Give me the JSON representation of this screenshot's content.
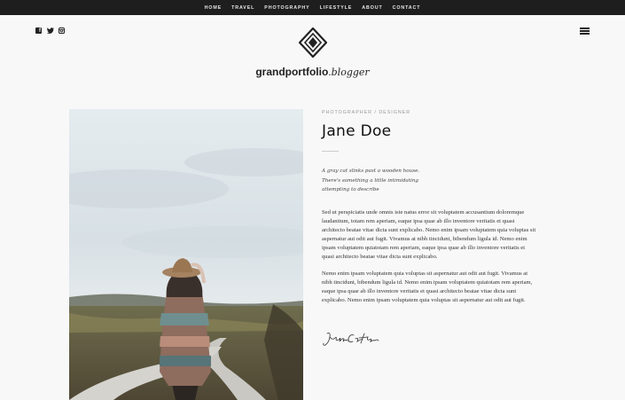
{
  "nav": {
    "items": [
      "HOME",
      "TRAVEL",
      "PHOTOGRAPHY",
      "LIFESTYLE",
      "ABOUT",
      "CONTACT"
    ]
  },
  "social": {
    "icons": [
      "facebook-icon",
      "twitter-icon",
      "instagram-icon"
    ]
  },
  "menu_icon": "hamburger-icon",
  "logo": {
    "text_bold": "grandportfolio",
    "text_dot": ".",
    "text_italic": "blogger"
  },
  "profile": {
    "subtitle": "PHOTOGRAPHER / DESIGNER",
    "name": "Jane Doe",
    "quote_lines": [
      "A gray cat slinks past a wooden house.",
      "There's something a little intimidating",
      "attempting to describe"
    ],
    "paragraph1_lines": [
      "Sed ut perspiciatis unde omnis iste natus error sit voluptatem accusantium doloremque",
      "laudantium, totam rem aperiam, eaque ipsa quae ab illo inventore veritatis et quasi",
      "architecto beatae vitae dicta sunt explicabo. Nemo enim ipsam voluptatem quia voluptas sit",
      "aspernatur aut odit aut fugit. Vivamus at nibh tincidunt, bibendum ligula id. Nemo enim",
      "ipsam voluptatem quiatotam rem aperiam, eaque ipsa quae ab illo inventore veritatis et",
      "quasi architecto beatae vitae dicta sunt explicabo."
    ],
    "paragraph2_lines": [
      "Nemo enim ipsam voluptatem quia voluptas sit aspernatur aut odit aut fugit. Vivamus at",
      "nibh tincidunt, bibendum ligula id. Nemo enim ipsam voluptatem quiatotam rem aperiam,",
      "eaque ipsa quae ab illo inventore veritatis et quasi architecto beatae vitae dicta sunt",
      "explicabo. Nemo enim ipsam voluptatem quia voluptas sit aspernatur aut odit aut fugit."
    ],
    "signature": "Jennifer Carter"
  },
  "colors": {
    "topbar": "#1e1e1e",
    "page_bg": "#f8f8f8",
    "text_dark": "#222222"
  }
}
